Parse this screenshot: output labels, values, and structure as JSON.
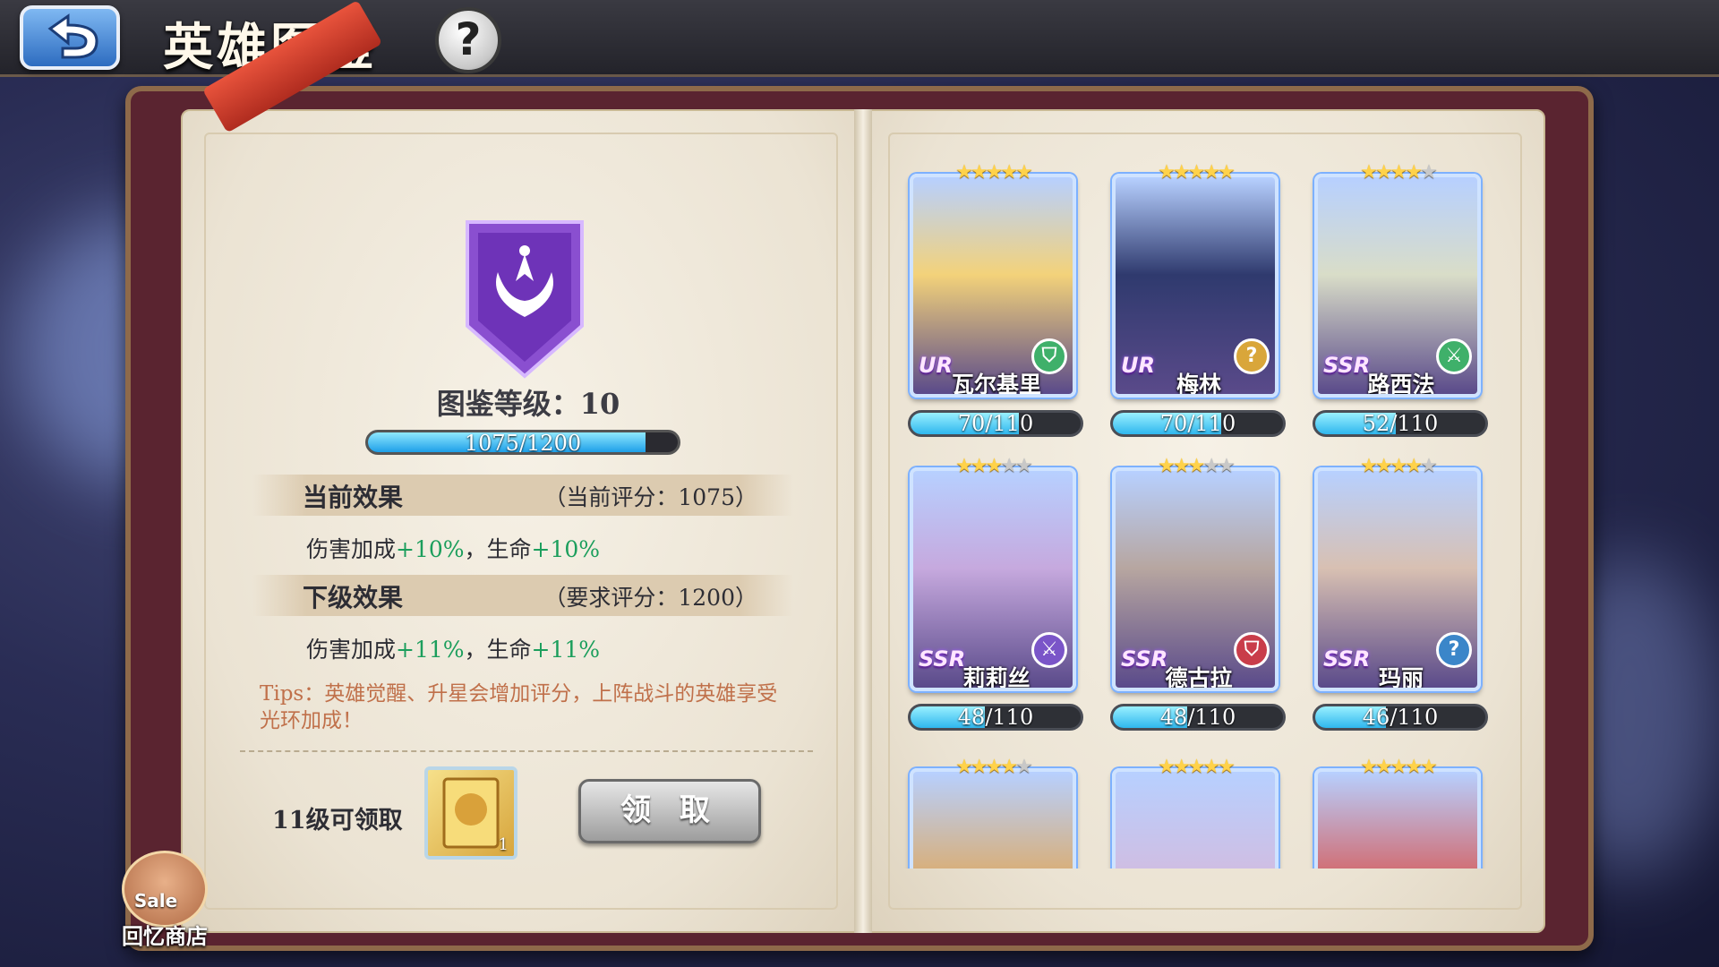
{
  "header": {
    "title": "英雄图鉴",
    "back_icon": "back-arrow-icon",
    "help_label": "?"
  },
  "codex": {
    "level_label": "图鉴等级：10",
    "xp_current": 1075,
    "xp_max": 1200,
    "xp_text": "1075/1200",
    "current_effect": {
      "title": "当前效果",
      "note": "（当前评分：1075）",
      "text_prefix": "伤害加成",
      "damage": "+10%",
      "sep": "，生命",
      "life": "+10%"
    },
    "next_effect": {
      "title": "下级效果",
      "note": "（要求评分：1200）",
      "text_prefix": "伤害加成",
      "damage": "+11%",
      "sep": "，生命",
      "life": "+11%"
    },
    "tips": "Tips：英雄觉醒、升星会增加评分，上阵战斗的英雄享受光环加成！",
    "reward_label": "11级可领取",
    "reward_count": "1",
    "claim_label": "领 取"
  },
  "shop": {
    "sale_label": "Sale",
    "label": "回忆商店"
  },
  "heroes": [
    {
      "name": "瓦尔基里",
      "rarity": "UR",
      "stars": 5,
      "progress": "70/110",
      "ratio": 0.636,
      "class_icon": "shield-class-icon",
      "color": "#3fb06a",
      "skin": "#f3d27a"
    },
    {
      "name": "梅林",
      "rarity": "UR",
      "stars": 5,
      "progress": "70/110",
      "ratio": 0.636,
      "class_icon": "question-class-icon",
      "color": "#d9a63a",
      "skin": "#2f3a6e"
    },
    {
      "name": "路西法",
      "rarity": "SSR",
      "stars": 4,
      "progress": "52/110",
      "ratio": 0.473,
      "class_icon": "sword-class-icon",
      "color": "#3fb06a",
      "skin": "#d9ddc8"
    },
    {
      "name": "莉莉丝",
      "rarity": "SSR",
      "stars": 3,
      "progress": "48/110",
      "ratio": 0.436,
      "class_icon": "sword-class-icon",
      "color": "#7a55c8",
      "skin": "#c6a9de"
    },
    {
      "name": "德古拉",
      "rarity": "SSR",
      "stars": 3,
      "progress": "48/110",
      "ratio": 0.436,
      "class_icon": "shield-class-icon",
      "color": "#c93d4a",
      "skin": "#b7a6a0"
    },
    {
      "name": "玛丽",
      "rarity": "SSR",
      "stars": 4,
      "progress": "46/110",
      "ratio": 0.418,
      "class_icon": "question-class-icon",
      "color": "#3b86c9",
      "skin": "#d8c0b2"
    }
  ],
  "heroes_partial": [
    {
      "stars": 4,
      "skin": "#e2a552"
    },
    {
      "stars": 5,
      "skin": "#d7b8da"
    },
    {
      "stars": 5,
      "skin": "#d9504a"
    }
  ]
}
